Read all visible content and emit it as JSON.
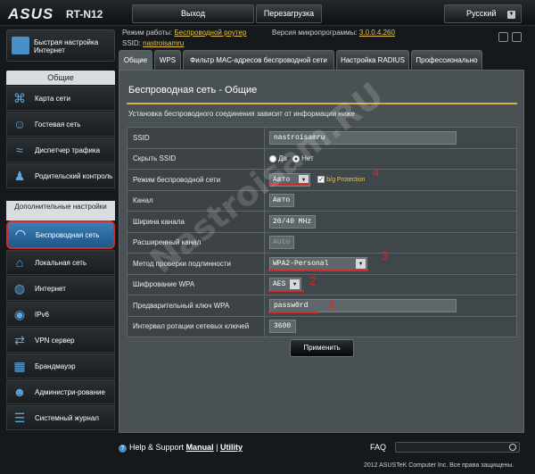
{
  "header": {
    "brand": "ASUS",
    "model": "RT-N12",
    "logout_label": "Выход",
    "reboot_label": "Перезагрузка",
    "language": "Русский"
  },
  "status": {
    "mode_label": "Режим работы:",
    "mode_value": "Беспроводной роутер",
    "firmware_label": "Версия микропрограммы:",
    "firmware_value": "3.0.0.4.260",
    "ssid_label": "SSID:",
    "ssid_value": "nastroisamru"
  },
  "sidebar": {
    "quick_setup": "Быстрая настройка Интернет",
    "general_header": "Общие",
    "general_items": [
      {
        "label": "Карта сети",
        "icon": "network-map-icon"
      },
      {
        "label": "Гостевая сеть",
        "icon": "guest-network-icon"
      },
      {
        "label": "Диспетчер трафика",
        "icon": "traffic-manager-icon"
      },
      {
        "label": "Родительский контроль",
        "icon": "parental-control-icon"
      }
    ],
    "advanced_header": "Дополнительные настройки",
    "advanced_items": [
      {
        "label": "Беспроводная сеть",
        "icon": "wireless-icon",
        "active": true
      },
      {
        "label": "Локальная сеть",
        "icon": "lan-icon"
      },
      {
        "label": "Интернет",
        "icon": "globe-icon"
      },
      {
        "label": "IPv6",
        "icon": "ipv6-icon"
      },
      {
        "label": "VPN сервер",
        "icon": "vpn-icon"
      },
      {
        "label": "Брандмауэр",
        "icon": "firewall-icon"
      },
      {
        "label": "Администри-рование",
        "icon": "admin-icon"
      },
      {
        "label": "Системный журнал",
        "icon": "syslog-icon"
      }
    ]
  },
  "tabs": [
    {
      "label": "Общие",
      "active": true
    },
    {
      "label": "WPS"
    },
    {
      "label": "Фильтр MAC-адресов беспроводной сети"
    },
    {
      "label": "Настройка RADIUS"
    },
    {
      "label": "Профессионально"
    }
  ],
  "panel": {
    "title": "Беспроводная сеть - Общие",
    "description": "Установка беспроводного соединения зависит от информации ниже",
    "rows": {
      "ssid": {
        "label": "SSID",
        "value": "nastroisamru"
      },
      "hide_ssid": {
        "label": "Скрыть SSID",
        "yes": "Да",
        "no": "Нет",
        "selected": "Нет"
      },
      "mode": {
        "label": "Режим беспроводной сети",
        "value": "Авто",
        "protection": "b/g Protection"
      },
      "channel": {
        "label": "Канал",
        "value": "Авто"
      },
      "bandwidth": {
        "label": "Ширина канала",
        "value": "20/40 MHz"
      },
      "ext_channel": {
        "label": "Расширенный канал",
        "value": "Auto"
      },
      "auth": {
        "label": "Метод проверки подлинности",
        "value": "WPA2-Personal"
      },
      "encryption": {
        "label": "Шифрование WPA",
        "value": "AES"
      },
      "psk": {
        "label": "Предварительный ключ WPA",
        "value": "passw0rd"
      },
      "rotation": {
        "label": "Интервал ротации сетевых ключей",
        "value": "3600"
      }
    },
    "apply_label": "Применить"
  },
  "annotations": [
    "4",
    "3",
    "2",
    "1"
  ],
  "footer": {
    "help": "Help & Support",
    "manual": "Manual",
    "separator": "|",
    "utility": "Utility",
    "faq": "FAQ",
    "copyright": "2012 ASUSTeK Computer Inc. Все права защищены."
  },
  "watermark": "Nastroisam.RU",
  "colors": {
    "accent": "#d3b04a",
    "annotation": "#d42a2a",
    "active_nav": "#2a6aa3"
  }
}
